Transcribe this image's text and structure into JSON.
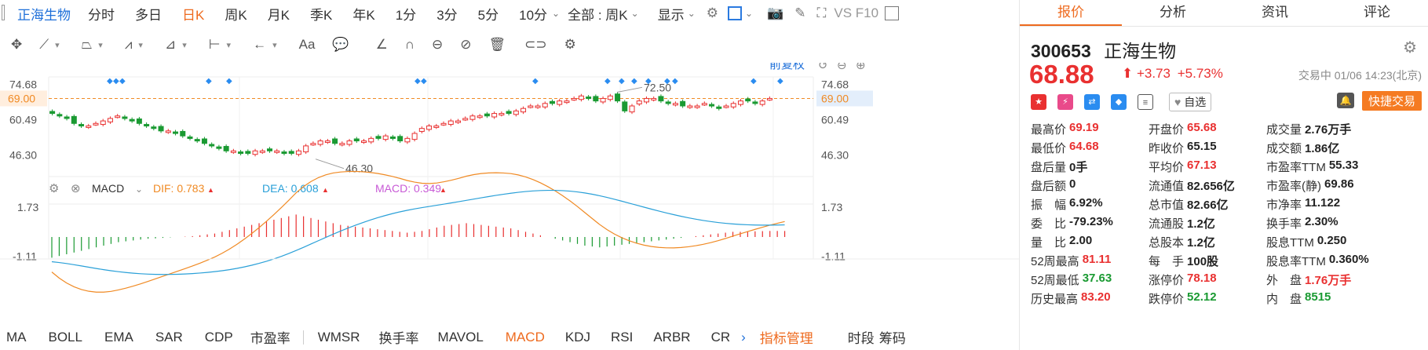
{
  "topbar": {
    "stock_name": "正海生物",
    "tabs": [
      "分时",
      "多日",
      "日K",
      "周K",
      "月K",
      "季K",
      "年K",
      "1分",
      "3分",
      "5分",
      "10分"
    ],
    "active_tab": "日K",
    "range_select": "全部 : 周K",
    "display_label": "显示",
    "vs_label": "VS F10"
  },
  "toolbar": {
    "font_label": "Aa"
  },
  "chart": {
    "restore_label": "前复权",
    "y_labels_left": [
      "74.68",
      "69.00",
      "60.49",
      "46.30"
    ],
    "y_labels_right": [
      "74.68",
      "69.00",
      "60.49",
      "46.30"
    ],
    "current_price_label": "69.00",
    "max_label": "72.50",
    "min_label": "46.30",
    "macd": {
      "name": "MACD",
      "dif": "DIF: 0.783",
      "dea": "DEA: 0.608",
      "macd": "MACD: 0.349",
      "y_labels": [
        "1.73",
        "-1.11"
      ]
    },
    "colors": {
      "up": "#e93030",
      "down": "#1a9a32",
      "dif": "#f08a24",
      "dea": "#2aa0d8",
      "macd_label": "#c85ad6",
      "marker": "#2a8cf0",
      "cur_line": "#f08a24"
    },
    "chart_data": {
      "type": "candlestick",
      "closes": [
        63,
        62,
        61,
        59,
        58,
        58,
        59,
        60,
        61,
        62,
        61,
        60,
        59,
        58,
        57,
        56,
        56,
        55,
        54,
        53,
        52,
        51,
        50,
        49,
        48,
        48,
        47,
        47,
        48,
        48,
        48,
        48,
        47,
        47,
        48,
        50,
        51,
        52,
        52,
        51,
        51,
        52,
        52,
        52,
        53,
        53,
        54,
        53,
        52,
        53,
        55,
        57,
        58,
        58,
        59,
        60,
        60,
        61,
        62,
        62,
        62,
        63,
        63,
        63,
        64,
        65,
        66,
        66,
        67,
        67,
        68,
        68,
        69,
        70,
        69,
        68,
        69,
        70,
        68,
        64,
        66,
        68,
        69,
        69,
        68,
        67,
        67,
        66,
        66,
        66,
        67,
        66,
        65,
        66,
        67,
        68,
        68,
        67,
        68,
        69
      ],
      "macd_hist": [
        -1.2,
        -1.1,
        -1.0,
        -0.9,
        -0.8,
        -0.7,
        -0.6,
        -0.5,
        -0.4,
        -0.3,
        -0.25,
        -0.2,
        -0.15,
        -0.1,
        -0.08,
        -0.05,
        -0.02,
        0.0,
        0.02,
        0.05,
        0.1,
        0.15,
        0.2,
        0.3,
        0.4,
        0.5,
        0.6,
        0.7,
        0.8,
        0.9,
        1.0,
        1.1,
        1.2,
        1.3,
        1.2,
        1.1,
        1.0,
        0.9,
        0.8,
        0.7,
        0.65,
        0.6,
        0.55,
        0.5,
        0.45,
        0.4,
        0.35,
        0.3,
        0.25,
        0.3,
        0.35,
        0.45,
        0.55,
        0.65,
        0.7,
        0.75,
        0.8,
        0.75,
        0.7,
        0.65,
        0.6,
        0.55,
        0.5,
        0.4,
        0.3,
        0.2,
        0.1,
        0.0,
        -0.1,
        -0.2,
        -0.3,
        -0.4,
        -0.5,
        -0.55,
        -0.6,
        -0.55,
        -0.5,
        -0.45,
        -0.4,
        -0.35,
        -0.3,
        -0.25,
        -0.2,
        -0.15,
        -0.1,
        -0.05,
        0.0,
        0.05,
        0.1,
        0.15,
        0.2,
        0.25,
        0.3,
        0.3,
        0.32,
        0.33,
        0.34,
        0.35,
        0.35,
        0.349
      ]
    }
  },
  "bottom_tabs": [
    "MA",
    "BOLL",
    "EMA",
    "SAR",
    "CDP",
    "市盈率",
    "WMSR",
    "换手率",
    "MAVOL",
    "MACD",
    "KDJ",
    "RSI",
    "ARBR",
    "CR",
    "指标管理",
    "时段",
    "筹码"
  ],
  "bottom_active": "MACD",
  "right": {
    "tabs": [
      "报价",
      "分析",
      "资讯",
      "评论"
    ],
    "active_tab": "报价",
    "code": "300653",
    "name": "正海生物",
    "price": "68.88",
    "arrow": "⬆",
    "change": "+3.73",
    "change_pct": "+5.73%",
    "status": "交易中 01/06 14:23(北京)",
    "fav_label": "自选",
    "trade_label": "快捷交易",
    "quotes": [
      [
        [
          "最高价",
          "69.19",
          "red"
        ],
        [
          "开盘价",
          "65.68",
          "red"
        ],
        [
          "成交量",
          "2.76万手",
          "norm"
        ]
      ],
      [
        [
          "最低价",
          "64.68",
          "red"
        ],
        [
          "昨收价",
          "65.15",
          "norm"
        ],
        [
          "成交额",
          "1.86亿",
          "norm"
        ]
      ],
      [
        [
          "盘后量",
          "0手",
          "norm"
        ],
        [
          "平均价",
          "67.13",
          "red"
        ],
        [
          "市盈率TTM",
          "55.33",
          "norm"
        ]
      ],
      [
        [
          "盘后额",
          "0",
          "norm"
        ],
        [
          "流通值",
          "82.656亿",
          "norm"
        ],
        [
          "市盈率(静)",
          "69.86",
          "norm"
        ]
      ],
      [
        [
          "振　幅",
          "6.92%",
          "norm"
        ],
        [
          "总市值",
          "82.66亿",
          "norm"
        ],
        [
          "市净率",
          "11.122",
          "norm"
        ]
      ],
      [
        [
          "委　比",
          "-79.23%",
          "norm"
        ],
        [
          "流通股",
          "1.2亿",
          "norm"
        ],
        [
          "换手率",
          "2.30%",
          "norm"
        ]
      ],
      [
        [
          "量　比",
          "2.00",
          "norm"
        ],
        [
          "总股本",
          "1.2亿",
          "norm"
        ],
        [
          "股息TTM",
          "0.250",
          "norm"
        ]
      ],
      [
        [
          "52周最高",
          "81.11",
          "red"
        ],
        [
          "每　手",
          "100股",
          "norm"
        ],
        [
          "股息率TTM",
          "0.360%",
          "norm"
        ]
      ],
      [
        [
          "52周最低",
          "37.63",
          "green"
        ],
        [
          "涨停价",
          "78.18",
          "red"
        ],
        [
          "外　盘",
          "1.76万手",
          "red"
        ]
      ],
      [
        [
          "历史最高",
          "83.20",
          "red"
        ],
        [
          "跌停价",
          "52.12",
          "green"
        ],
        [
          "内　盘",
          "8515",
          "green"
        ]
      ]
    ]
  }
}
